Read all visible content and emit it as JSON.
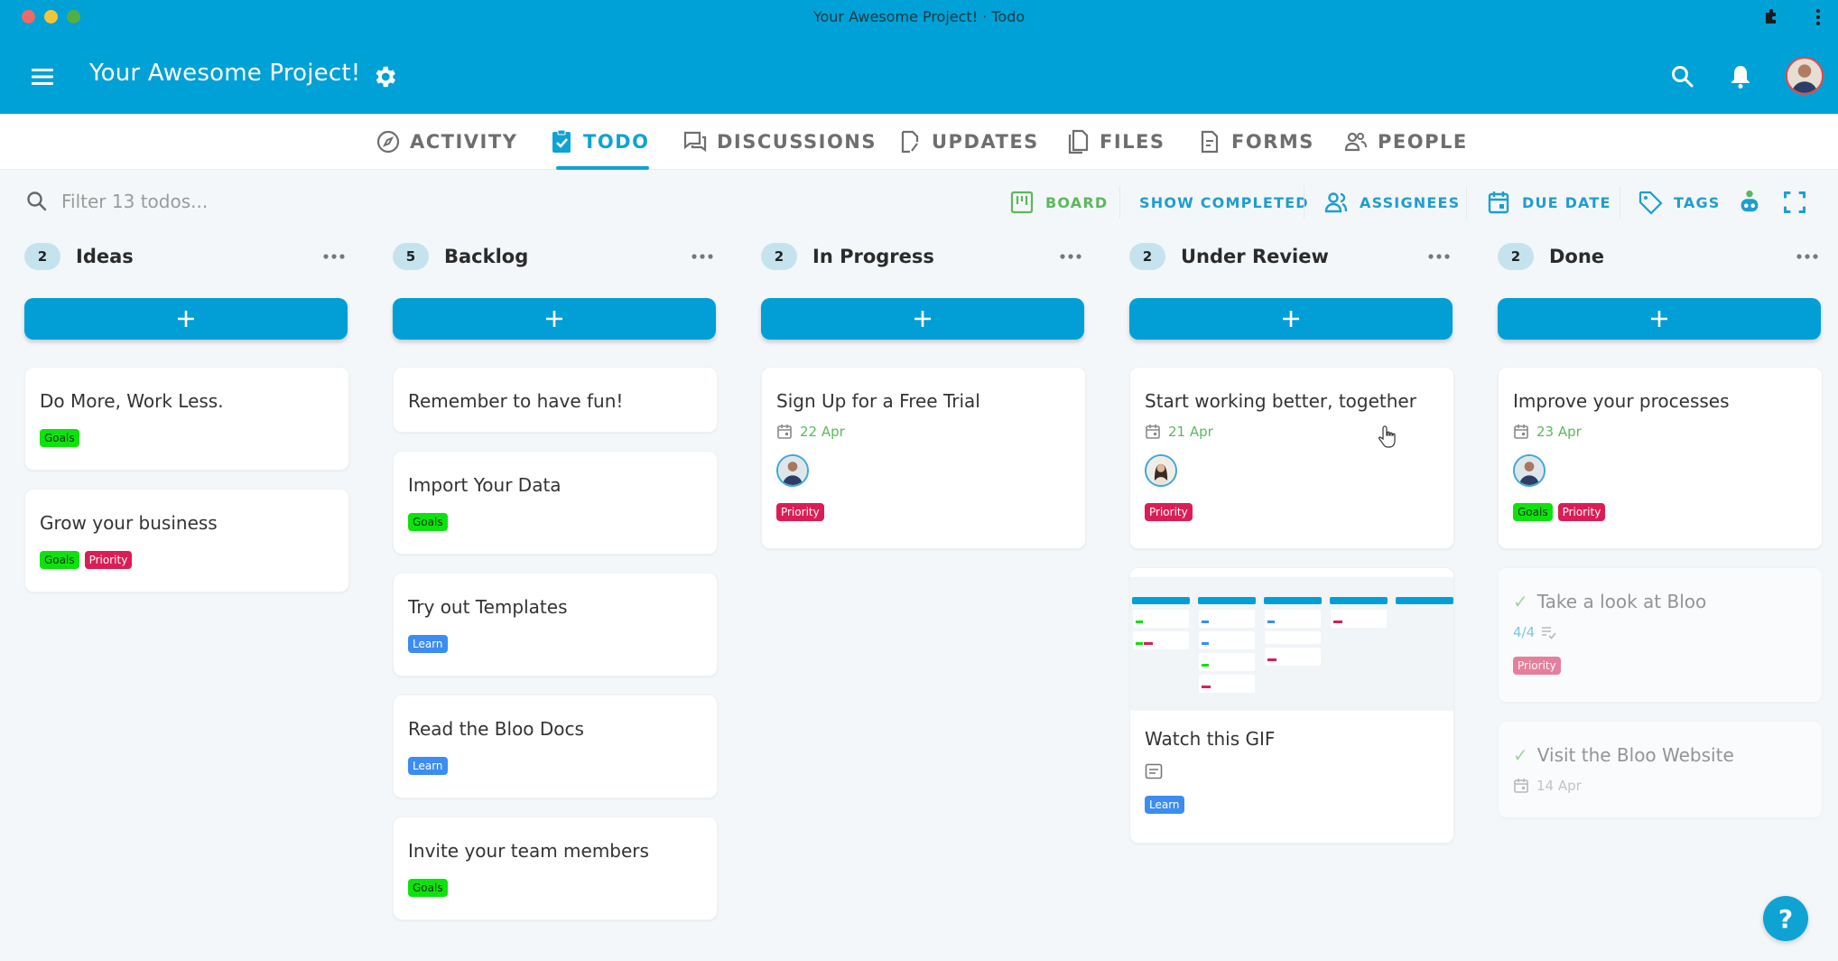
{
  "window": {
    "title": "Your Awesome Project! · Todo",
    "traffic_colors": [
      "#ee6a6a",
      "#f2c43b",
      "#52b043"
    ]
  },
  "header": {
    "project_title": "Your Awesome Project!",
    "bg_color": "#00a1d6"
  },
  "tabs": [
    {
      "label": "ACTIVITY",
      "icon": "compass-icon",
      "active": false
    },
    {
      "label": "TODO",
      "icon": "clipboard-check-icon",
      "active": true
    },
    {
      "label": "DISCUSSIONS",
      "icon": "chat-icon",
      "active": false
    },
    {
      "label": "UPDATES",
      "icon": "document-edit-icon",
      "active": false
    },
    {
      "label": "FILES",
      "icon": "files-icon",
      "active": false
    },
    {
      "label": "FORMS",
      "icon": "form-icon",
      "active": false
    },
    {
      "label": "PEOPLE",
      "icon": "people-icon",
      "active": false
    }
  ],
  "filter": {
    "placeholder": "Filter 13 todos..."
  },
  "toolbar": {
    "board": "BOARD",
    "show_completed": "SHOW COMPLETED",
    "assignees": "ASSIGNEES",
    "due_date": "DUE DATE",
    "tags": "TAGS"
  },
  "colors": {
    "accent": "#0fa3d4",
    "goals": "#0ce30c",
    "priority": "#dc1d55",
    "learn": "#3b8df1",
    "due_date": "#5cb85c"
  },
  "columns": [
    {
      "title": "Ideas",
      "count": "2",
      "cards": [
        {
          "title": "Do More, Work Less.",
          "tags": [
            "Goals"
          ]
        },
        {
          "title": "Grow your business",
          "tags": [
            "Goals",
            "Priority"
          ]
        }
      ]
    },
    {
      "title": "Backlog",
      "count": "5",
      "cards": [
        {
          "title": "Remember to have fun!",
          "tags": []
        },
        {
          "title": "Import Your Data",
          "tags": [
            "Goals"
          ]
        },
        {
          "title": "Try out Templates",
          "tags": [
            "Learn"
          ]
        },
        {
          "title": "Read the Bloo Docs",
          "tags": [
            "Learn"
          ]
        },
        {
          "title": "Invite your team members",
          "tags": [
            "Goals"
          ]
        }
      ]
    },
    {
      "title": "In Progress",
      "count": "2",
      "cards": [
        {
          "title": "Sign Up for a Free Trial",
          "due": "22 Apr",
          "assignee": "man",
          "tags": [
            "Priority"
          ]
        }
      ]
    },
    {
      "title": "Under Review",
      "count": "2",
      "cards": [
        {
          "title": "Start working better, together",
          "due": "21 Apr",
          "assignee": "woman",
          "tags": [
            "Priority"
          ]
        },
        {
          "title": "Watch this GIF",
          "has_image": true,
          "has_description": true,
          "tags": [
            "Learn"
          ]
        }
      ]
    },
    {
      "title": "Done",
      "count": "2",
      "cards": [
        {
          "title": "Improve your processes",
          "due": "23 Apr",
          "assignee": "man",
          "tags": [
            "Goals",
            "Priority"
          ]
        },
        {
          "title": "Take a look at Bloo",
          "completed": true,
          "checklist": "4/4",
          "tags": [
            "Priority"
          ]
        },
        {
          "title": "Visit the Bloo Website",
          "completed": true,
          "due": "14 Apr",
          "tags": []
        }
      ]
    }
  ],
  "help": {
    "label": "?"
  }
}
